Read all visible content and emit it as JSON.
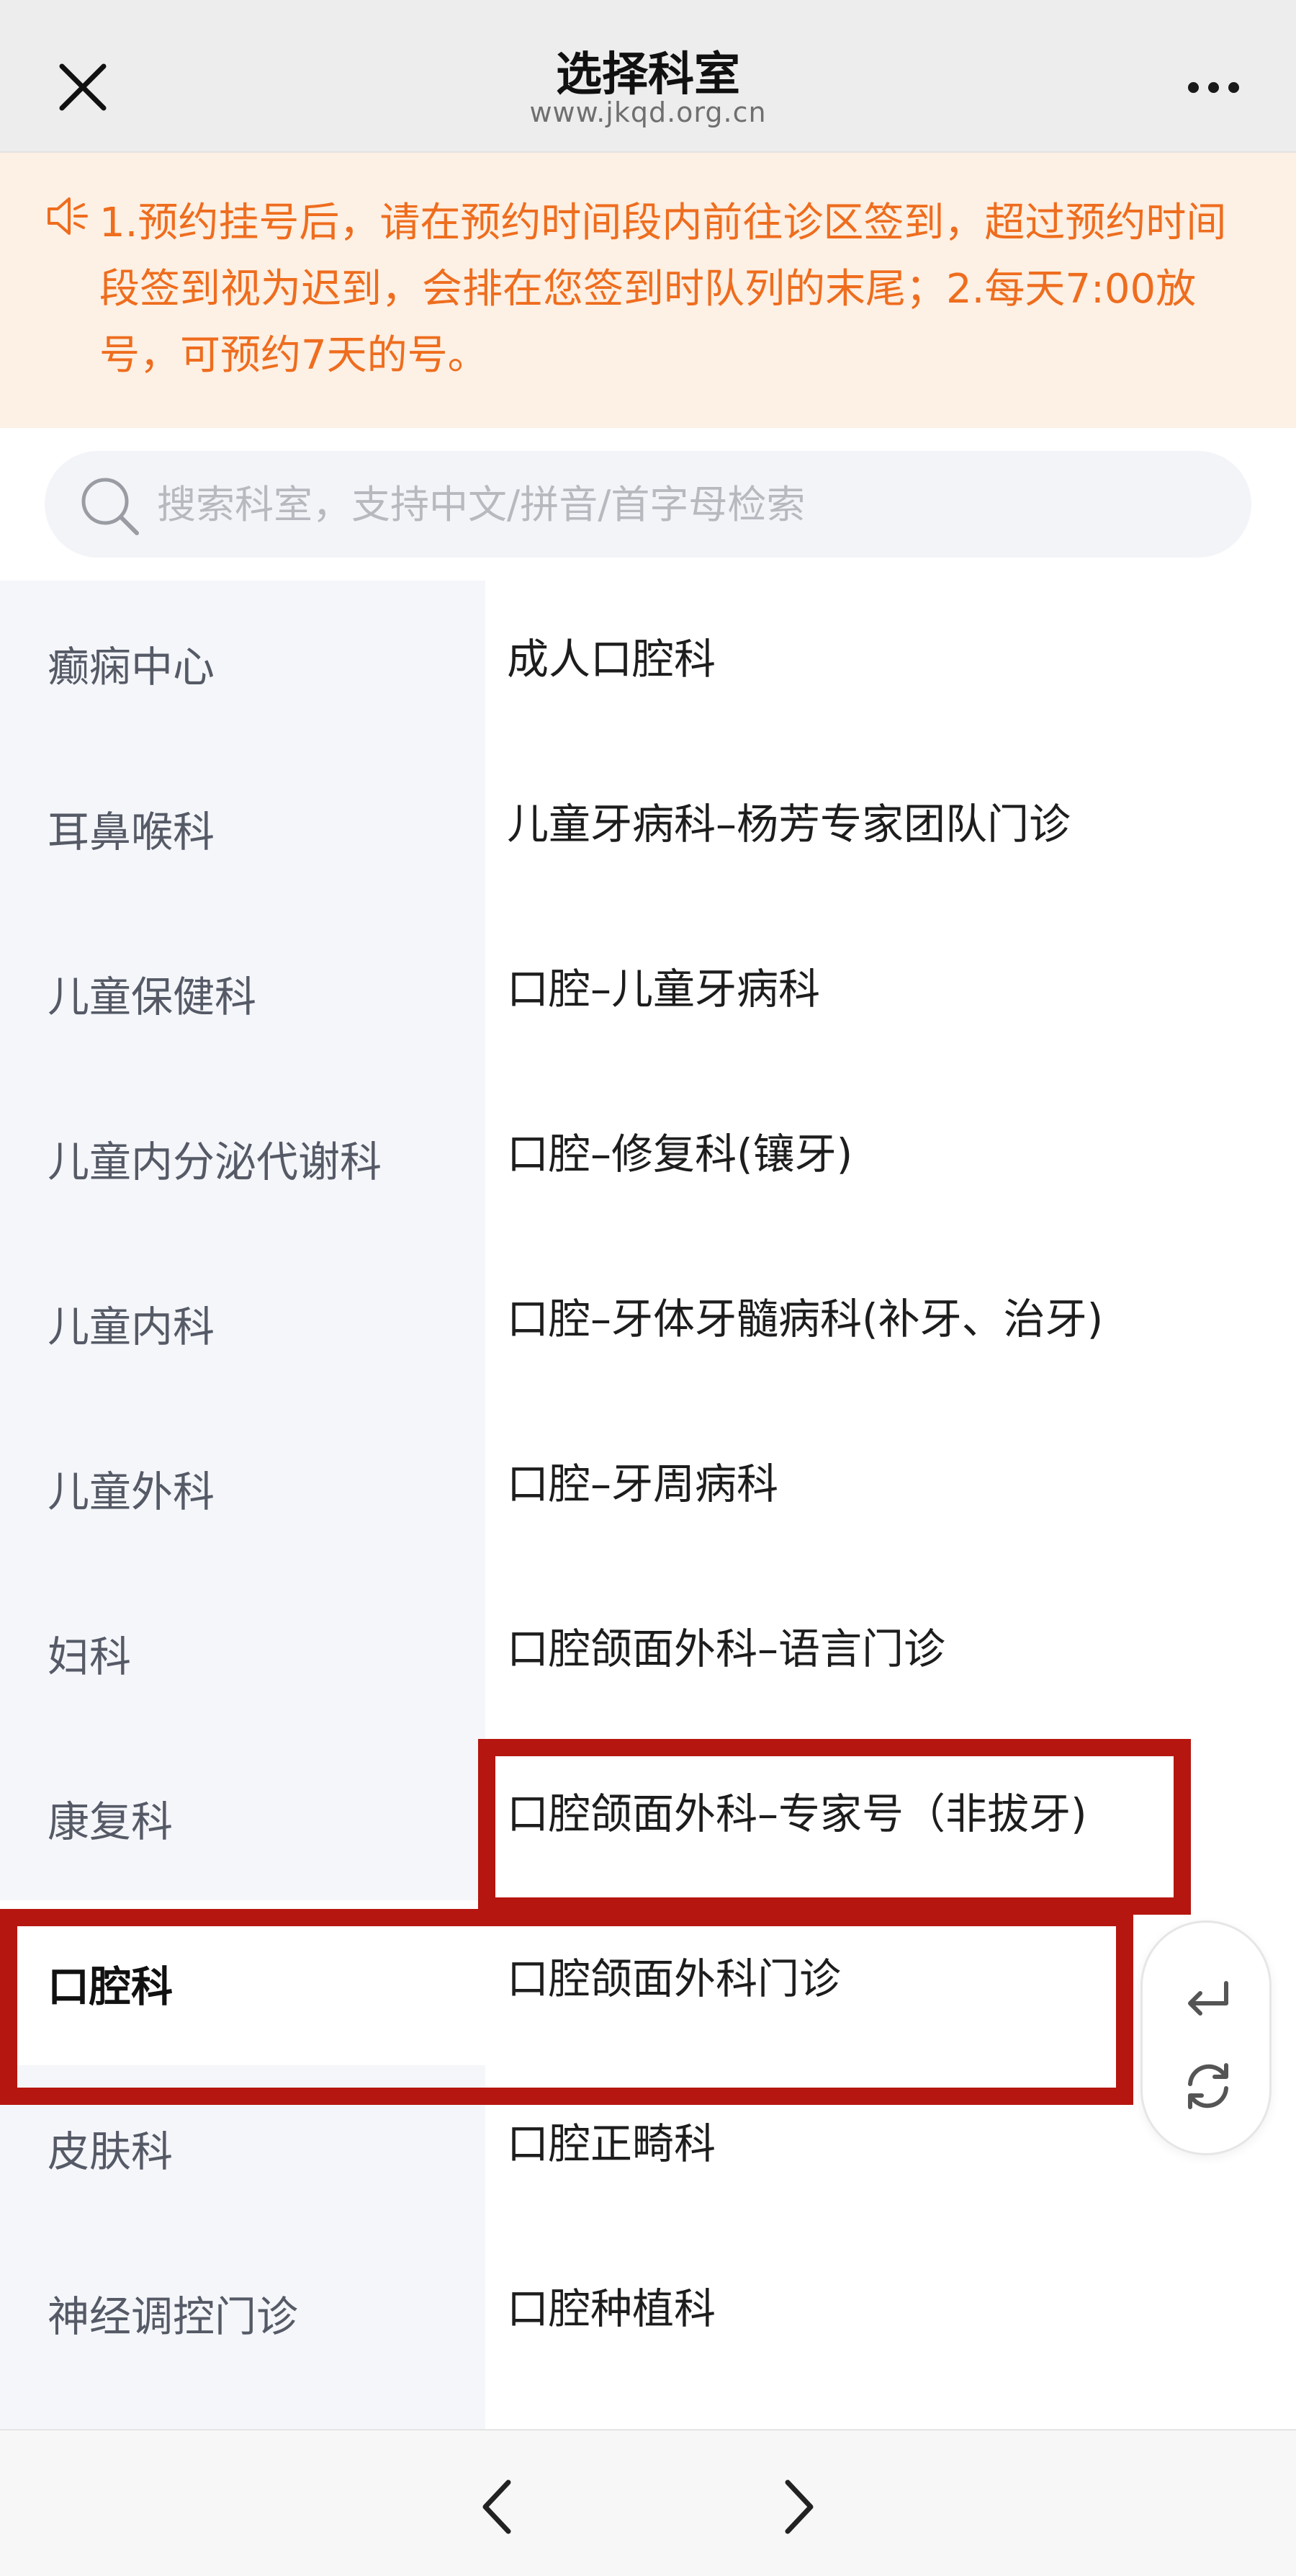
{
  "header": {
    "title": "选择科室",
    "subtitle": "www.jkqd.org.cn",
    "close_icon": "close-icon",
    "more_icon": "more-icon"
  },
  "notice": {
    "icon": "speaker-icon",
    "text": "1.预约挂号后，请在预约时间段内前往诊区签到，超过预约时间段签到视为迟到，会排在您签到时队列的末尾；2.每天7:00放号，可预约7天的号。"
  },
  "search": {
    "placeholder": "搜索科室，支持中文/拼音/首字母检索",
    "value": ""
  },
  "categories": [
    {
      "label": "癫痫中心"
    },
    {
      "label": "耳鼻喉科"
    },
    {
      "label": "儿童保健科"
    },
    {
      "label": "儿童内分泌代谢科"
    },
    {
      "label": "儿童内科"
    },
    {
      "label": "儿童外科"
    },
    {
      "label": "妇科"
    },
    {
      "label": "康复科"
    },
    {
      "label": "口腔科",
      "selected": true
    },
    {
      "label": "皮肤科"
    },
    {
      "label": "神经调控门诊"
    }
  ],
  "departments": [
    {
      "label": "成人口腔科"
    },
    {
      "label": "儿童牙病科–杨芳专家团队门诊"
    },
    {
      "label": "口腔–儿童牙病科"
    },
    {
      "label": "口腔–修复科(镶牙)"
    },
    {
      "label": "口腔–牙体牙髓病科(补牙、治牙)"
    },
    {
      "label": "口腔–牙周病科"
    },
    {
      "label": "口腔颌面外科–语言门诊"
    },
    {
      "label": "口腔颌面外科–专家号（非拔牙)"
    },
    {
      "label": "口腔颌面外科门诊"
    },
    {
      "label": "口腔正畸科"
    },
    {
      "label": "口腔种植科"
    }
  ],
  "colors": {
    "highlight": "#b5160f",
    "notice_text": "#ee6d1e",
    "notice_bg": "#fdf0e4"
  },
  "float": {
    "return_icon": "return-icon",
    "refresh_icon": "refresh-icon"
  },
  "bottom_nav": {
    "back_icon": "chevron-left-icon",
    "forward_icon": "chevron-right-icon"
  }
}
